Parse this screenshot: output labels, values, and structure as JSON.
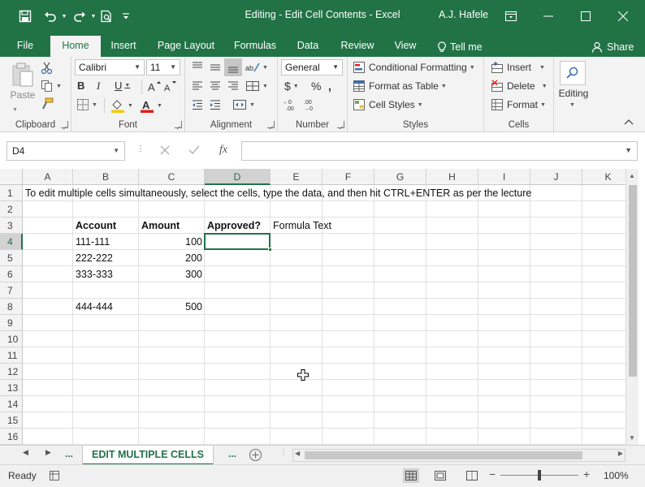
{
  "window": {
    "title": "Editing - Edit Cell Contents  -  Excel",
    "user": "A.J. Hafele"
  },
  "tabs": {
    "file": "File",
    "home": "Home",
    "insert": "Insert",
    "page_layout": "Page Layout",
    "formulas": "Formulas",
    "data": "Data",
    "review": "Review",
    "view": "View",
    "tell_me": "Tell me",
    "share": "Share"
  },
  "ribbon": {
    "clipboard": {
      "label": "Clipboard",
      "paste": "Paste"
    },
    "font": {
      "label": "Font",
      "name": "Calibri",
      "size": "11",
      "bold": "B",
      "italic": "I",
      "underline": "U"
    },
    "alignment": {
      "label": "Alignment"
    },
    "number": {
      "label": "Number",
      "format": "General",
      "currency": "$",
      "percent": "%"
    },
    "styles": {
      "label": "Styles",
      "conditional": "Conditional Formatting",
      "format_table": "Format as Table",
      "cell_styles": "Cell Styles"
    },
    "cells": {
      "label": "Cells",
      "insert": "Insert",
      "delete": "Delete",
      "format": "Format"
    },
    "editing": {
      "label": "Editing"
    }
  },
  "formula_bar": {
    "name_box": "D4",
    "fx": "fx",
    "formula": ""
  },
  "sheet": {
    "columns": [
      "A",
      "B",
      "C",
      "D",
      "E",
      "F",
      "G",
      "H",
      "I",
      "J",
      "K"
    ],
    "selected_column": "D",
    "rows": [
      "1",
      "2",
      "3",
      "4",
      "5",
      "6",
      "7",
      "8",
      "9",
      "10",
      "11",
      "12",
      "13",
      "14",
      "15",
      "16"
    ],
    "selected_row": "4",
    "active_cell": "D4",
    "cells": {
      "A1": "To edit multiple cells simultaneously, select the cells, type the data, and then hit CTRL+ENTER as per the lecture",
      "B3": "Account",
      "C3": "Amount",
      "D3": "Approved?",
      "E3": "Formula Text",
      "B4": "111-111",
      "C4": "100",
      "B5": "222-222",
      "C5": "200",
      "B6": "333-333",
      "C6": "300",
      "B8": "444-444",
      "C8": "500"
    }
  },
  "sheet_tabs": {
    "more_left": "...",
    "active": "EDIT MULTIPLE CELLS",
    "more_right": "..."
  },
  "status": {
    "ready": "Ready",
    "zoom": "100%"
  },
  "colors": {
    "accent": "#217346",
    "font_color": "#e0201a",
    "fill_color": "#f2c811"
  }
}
